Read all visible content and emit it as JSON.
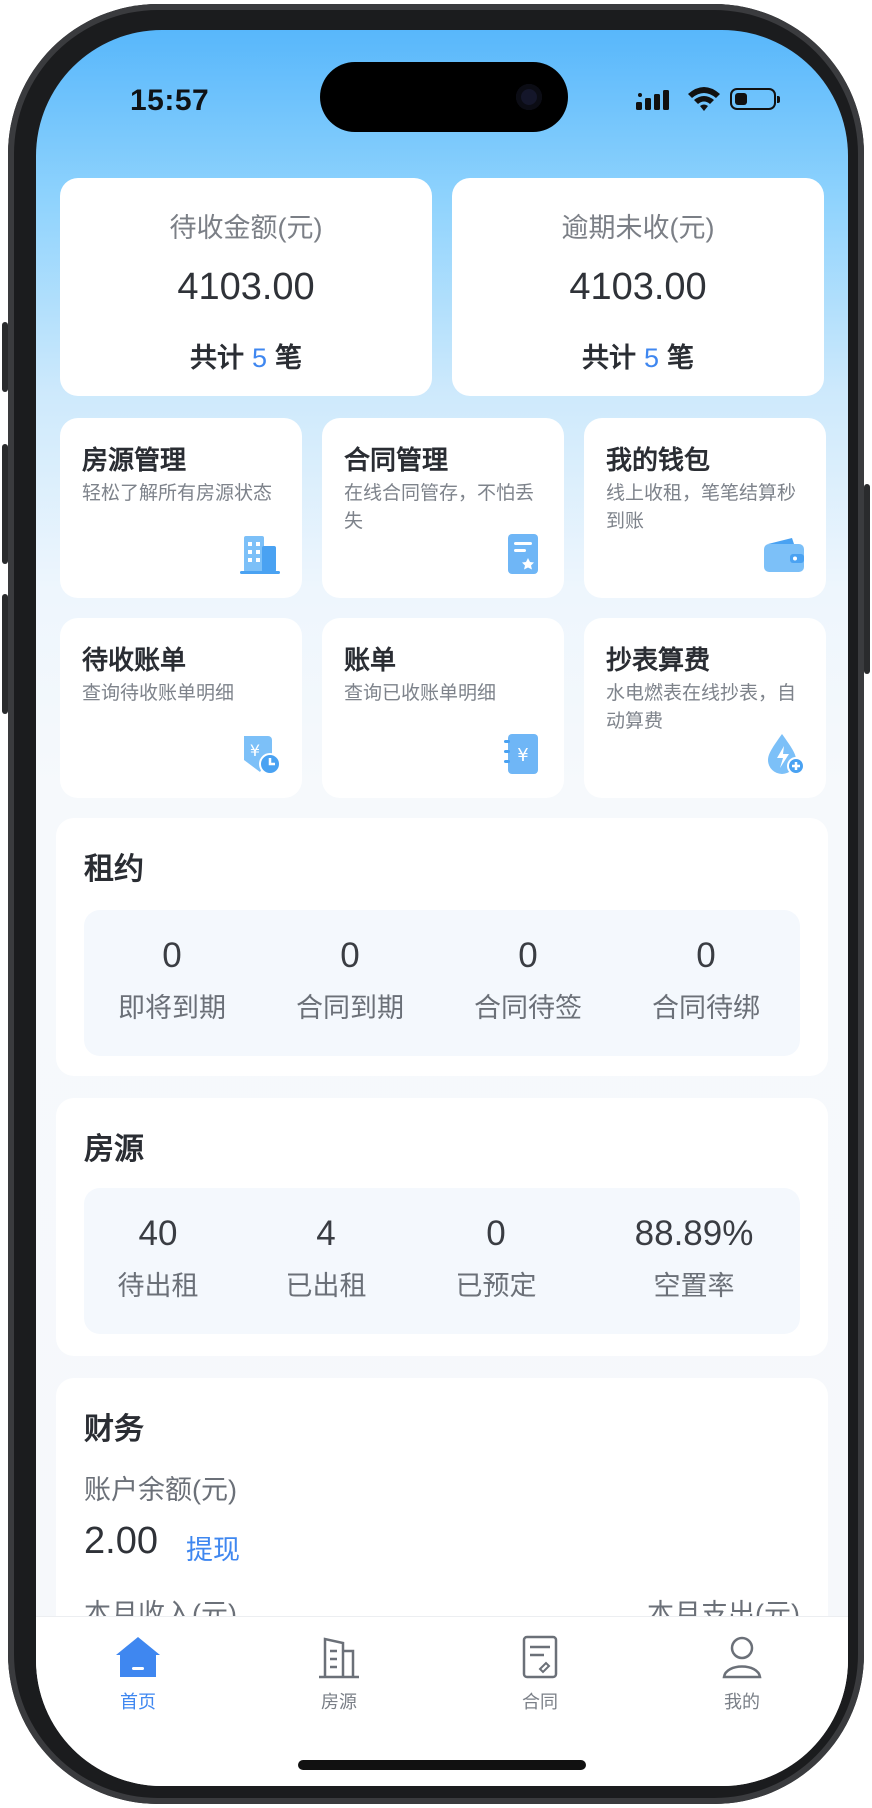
{
  "status_bar": {
    "time": "15:57"
  },
  "summary": [
    {
      "label": "待收金额(元)",
      "amount": "4103.00",
      "count_prefix": "共计",
      "count": "5",
      "count_suffix": "笔"
    },
    {
      "label": "逾期未收(元)",
      "amount": "4103.00",
      "count_prefix": "共计",
      "count": "5",
      "count_suffix": "笔"
    }
  ],
  "features": [
    {
      "title": "房源管理",
      "desc": "轻松了解所有房源状态",
      "icon": "building-icon"
    },
    {
      "title": "合同管理",
      "desc": "在线合同管存，不怕丢失",
      "icon": "contract-icon"
    },
    {
      "title": "我的钱包",
      "desc": "线上收租，笔笔结算秒到账",
      "icon": "wallet-icon"
    },
    {
      "title": "待收账单",
      "desc": "查询待收账单明细",
      "icon": "pending-bill-icon"
    },
    {
      "title": "账单",
      "desc": "查询已收账单明细",
      "icon": "bill-icon"
    },
    {
      "title": "抄表算费",
      "desc": "水电燃表在线抄表，自动算费",
      "icon": "meter-icon"
    }
  ],
  "lease": {
    "title": "租约",
    "stats": [
      {
        "value": "0",
        "label": "即将到期"
      },
      {
        "value": "0",
        "label": "合同到期"
      },
      {
        "value": "0",
        "label": "合同待签"
      },
      {
        "value": "0",
        "label": "合同待绑"
      }
    ]
  },
  "property": {
    "title": "房源",
    "stats": [
      {
        "value": "40",
        "label": "待出租"
      },
      {
        "value": "4",
        "label": "已出租"
      },
      {
        "value": "0",
        "label": "已预定"
      },
      {
        "value": "88.89%",
        "label": "空置率"
      }
    ]
  },
  "finance": {
    "title": "财务",
    "balance_label": "账户余额(元)",
    "balance": "2.00",
    "withdraw": "提现",
    "month_income_label": "本月收入(元)",
    "month_expense_label": "本月支出(元)"
  },
  "tabs": [
    {
      "label": "首页",
      "icon": "home-icon",
      "active": true
    },
    {
      "label": "房源",
      "icon": "building-icon",
      "active": false
    },
    {
      "label": "合同",
      "icon": "contract-icon",
      "active": false
    },
    {
      "label": "我的",
      "icon": "user-icon",
      "active": false
    }
  ],
  "colors": {
    "accent": "#3f87f0",
    "header_top": "#58b7fb",
    "icon_blue": "#6fb6f6"
  }
}
